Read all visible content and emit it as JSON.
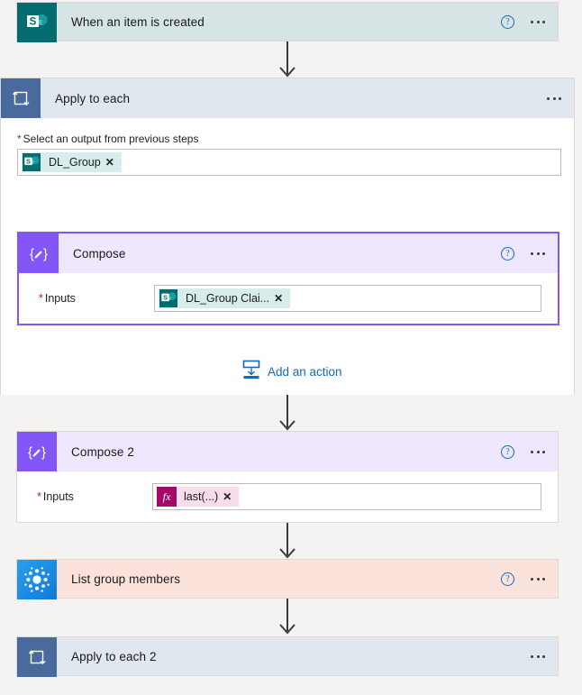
{
  "app": {
    "name": "power-automate-flow-designer",
    "background_color": "#f4f3f2"
  },
  "colors": {
    "sharepoint_teal": "#036c70",
    "loop_blue": "#486a9c",
    "compose_purple": "#8257f5",
    "azure_blue": "#1b93eb",
    "link_blue": "#0f6cbd",
    "required_red": "#a4262c",
    "token_teal_bg": "#d9ecec",
    "token_pink_bg": "#f7dcea",
    "fx_magenta": "#a4096c",
    "trigger_card_bg": "#d7e4e5",
    "loop_card_bg": "#e1e7ef",
    "compose_card_bg": "#eee7fd",
    "lgm_card_bg": "#fbe3db"
  },
  "trigger": {
    "title": "When an item is created",
    "icon": "sharepoint-icon",
    "help_label": "?",
    "menu_label": "..."
  },
  "apply_to_each": {
    "title": "Apply to each",
    "icon": "loop-icon",
    "menu_label": "...",
    "field": {
      "label": "Select an output from previous steps",
      "required_marker": "*",
      "token": {
        "label": "DL_Group",
        "icon": "sharepoint-icon",
        "remove_label": "✕"
      }
    },
    "compose": {
      "title": "Compose",
      "icon": "compose-icon",
      "help_label": "?",
      "menu_label": "...",
      "field": {
        "label": "Inputs",
        "required_marker": "*",
        "token": {
          "label": "DL_Group Clai...",
          "icon": "sharepoint-icon",
          "remove_label": "✕"
        }
      }
    },
    "add_action": {
      "label": "Add an action",
      "icon": "add-action-icon"
    }
  },
  "compose2": {
    "title": "Compose 2",
    "icon": "compose-icon",
    "help_label": "?",
    "menu_label": "...",
    "field": {
      "label": "Inputs",
      "required_marker": "*",
      "token": {
        "label": "last(...)",
        "icon": "fx-icon",
        "icon_text": "fx",
        "remove_label": "✕"
      }
    }
  },
  "list_group_members": {
    "title": "List group members",
    "icon": "azure-ad-icon",
    "help_label": "?",
    "menu_label": "..."
  },
  "apply_to_each_2": {
    "title": "Apply to each 2",
    "icon": "loop-icon",
    "menu_label": "..."
  }
}
